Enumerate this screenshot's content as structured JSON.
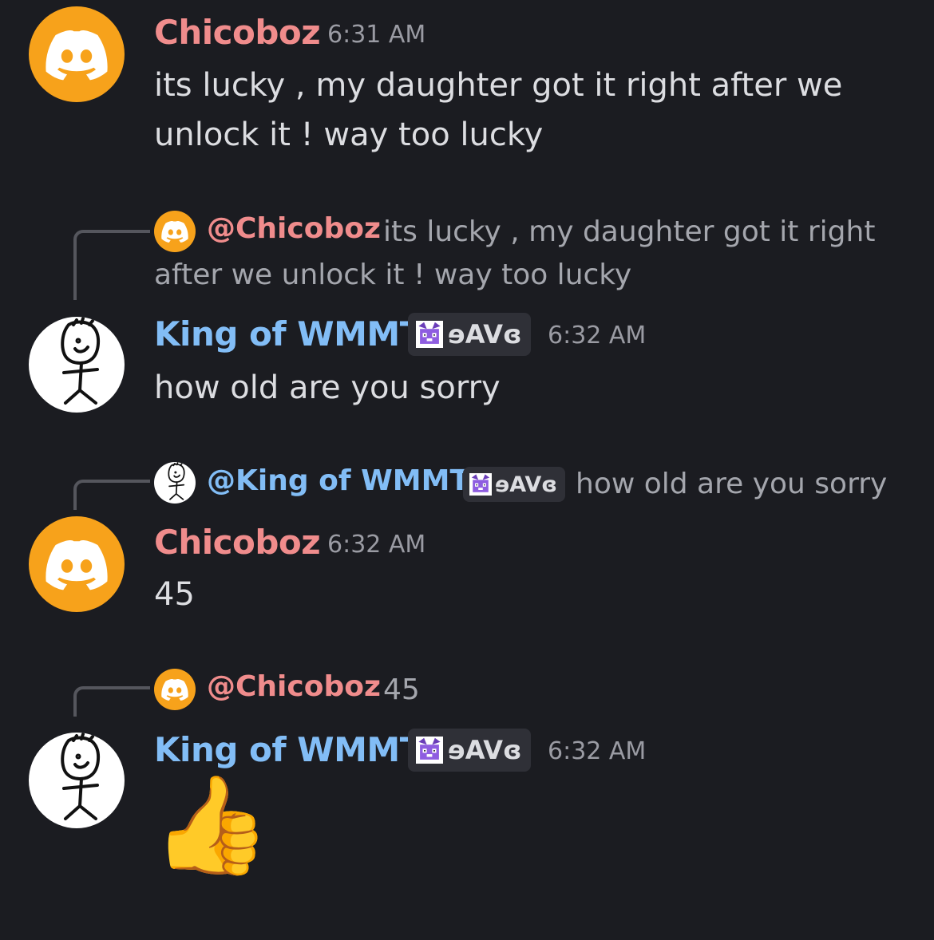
{
  "messages": [
    {
      "author": "Chicoboz",
      "time": "6:31 AM",
      "text_line1": "its lucky , my daughter got it right after we",
      "text_line2": "unlock it ! way too lucky"
    },
    {
      "reply_mention": "@Chicoboz",
      "reply_text_line1": "its lucky , my daughter got it right",
      "reply_text_line2": "after we unlock it ! way too lucky",
      "author": "King of WMMT",
      "tag": "ɘAVɞ",
      "time": "6:32 AM",
      "text": "how old are you sorry"
    },
    {
      "reply_mention": "@King of WMMT",
      "reply_tag": "ɘAVɞ",
      "reply_text": "how old are you sorry",
      "author": "Chicoboz",
      "time": "6:32 AM",
      "text": "45"
    },
    {
      "reply_mention": "@Chicoboz",
      "reply_text": "45",
      "author": "King of WMMT",
      "tag": "ɘAVɞ",
      "time": "6:32 AM",
      "emoji": "👍"
    }
  ],
  "icons": {
    "discord_avatar": "discord-logo-icon",
    "stick_avatar": "stick-figure-icon",
    "tag_icon": "purple-cat-icon",
    "reaction": "thumbs-up-emoji"
  },
  "colors": {
    "background": "#1b1c21",
    "chicoboz_name": "#f08c8c",
    "king_name": "#82bdf6",
    "discord_avatar_bg": "#f7a21b",
    "tag_bg": "#2f3037"
  }
}
